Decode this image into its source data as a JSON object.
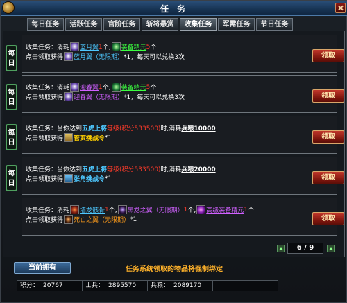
{
  "window": {
    "title": "任 务"
  },
  "tabs": [
    "每日任务",
    "活跃任务",
    "官阶任务",
    "斩将悬赏",
    "收集任务",
    "军需任务",
    "节日任务"
  ],
  "active_tab_index": 4,
  "daily_badge": [
    "每",
    "日"
  ],
  "claim_label": "领取",
  "tasks": [
    {
      "l1": {
        "prefix": "收集任务：消耗",
        "item1": "蓝月翼",
        "qty1": "1",
        "sep": "个,",
        "item2": "装备精元",
        "qty2": "5",
        "end": "个"
      },
      "l2": {
        "prefix": "点击领取获得",
        "reward": "蓝月翼（无限期）",
        "suffix": "*1，每天可以兑换3次"
      }
    },
    {
      "l1": {
        "prefix": "收集任务：消耗",
        "item1": "迎春翼",
        "qty1": "1",
        "sep": "个,",
        "item2": "装备精元",
        "qty2": "5",
        "end": "个"
      },
      "l2": {
        "prefix": "点击领取获得",
        "reward": "迎春翼（无限期）",
        "suffix": "*1，每天可以兑换3次"
      }
    },
    {
      "l1": {
        "prefix": "收集任务：当你达到",
        "rank": "五虎上将",
        "lvl": "等级",
        "score": "(积分533500)",
        "mid": "时,消耗",
        "cost": "兵粮10000"
      },
      "l2": {
        "prefix": "点击领取获得",
        "reward": "管亥挑战令",
        "suffix": "*1"
      }
    },
    {
      "l1": {
        "prefix": "收集任务：当你达到",
        "rank": "五虎上将",
        "lvl": "等级",
        "score": "(积分533500)",
        "mid": "时,消耗",
        "cost": "兵粮20000"
      },
      "l2": {
        "prefix": "点击领取获得",
        "reward": "张角挑战令",
        "suffix": "*1"
      }
    },
    {
      "l1": {
        "prefix": "收集任务：消耗",
        "item1": "墙龙骸骨",
        "qty1": "1",
        "sep1": "个,",
        "item2": "黑龙之翼（无限期）",
        "qty2": "1",
        "sep2": "个,",
        "item3": "高级装备精元",
        "qty3": "1",
        "end": "个"
      },
      "l2": {
        "prefix": "点击领取获得",
        "reward": "死亡之翼（无限期）",
        "suffix": "*1"
      }
    }
  ],
  "pager": {
    "text": "6 / 9",
    "current": 6,
    "total": 9
  },
  "current_owned_label": "当前拥有",
  "notice": "任务系统领取的物品将强制绑定",
  "stats": {
    "score_label": "积分：",
    "score_value": "20767",
    "soldier_label": "士兵：",
    "soldier_value": "2895570",
    "grain_label": "兵粮：",
    "grain_value": "2089170"
  },
  "icons": [
    "wing-icon",
    "essence-icon",
    "scroll-icon",
    "dragon-bone-icon",
    "black-wing-icon",
    "purple-essence-icon",
    "death-wing-icon"
  ]
}
